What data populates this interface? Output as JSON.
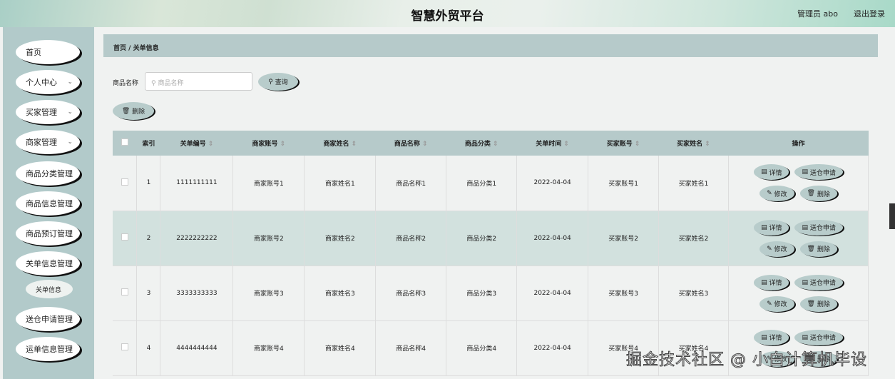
{
  "header": {
    "title": "智慧外贸平台",
    "user": "管理员 abo",
    "logout": "退出登录"
  },
  "sidebar": {
    "items": [
      {
        "label": "首页",
        "chevron": false
      },
      {
        "label": "个人中心",
        "chevron": true
      },
      {
        "label": "买家管理",
        "chevron": true
      },
      {
        "label": "商家管理",
        "chevron": true
      },
      {
        "label": "商品分类管理"
      },
      {
        "label": "商品信息管理"
      },
      {
        "label": "商品预订管理"
      },
      {
        "label": "关单信息管理"
      },
      {
        "label": "关单信息",
        "sub": true
      },
      {
        "label": "送仓申请管理"
      },
      {
        "label": "运单信息管理"
      }
    ]
  },
  "breadcrumb": {
    "home": "首页",
    "sep": "/",
    "current": "关单信息"
  },
  "search": {
    "label": "商品名称",
    "placeholder": "商品名称",
    "button": "查询"
  },
  "toolbar": {
    "delete": "删除"
  },
  "table": {
    "headers": [
      "索引",
      "关单编号",
      "商家账号",
      "商家姓名",
      "商品名称",
      "商品分类",
      "关单时间",
      "买家账号",
      "买家姓名",
      "操作"
    ],
    "rows": [
      [
        "1",
        "1111111111",
        "商家账号1",
        "商家姓名1",
        "商品名称1",
        "商品分类1",
        "2022-04-04",
        "买家账号1",
        "买家姓名1"
      ],
      [
        "2",
        "2222222222",
        "商家账号2",
        "商家姓名2",
        "商品名称2",
        "商品分类2",
        "2022-04-04",
        "买家账号2",
        "买家姓名2"
      ],
      [
        "3",
        "3333333333",
        "商家账号3",
        "商家姓名3",
        "商品名称3",
        "商品分类3",
        "2022-04-04",
        "买家账号3",
        "买家姓名3"
      ],
      [
        "4",
        "4444444444",
        "商家账号4",
        "商家姓名4",
        "商品名称4",
        "商品分类4",
        "2022-04-04",
        "买家账号4",
        "买家姓名4"
      ]
    ],
    "actions": [
      "详情",
      "送仓申请",
      "修改",
      "删除"
    ]
  },
  "watermark": "掘金技术社区 @ 小白计算机毕设"
}
